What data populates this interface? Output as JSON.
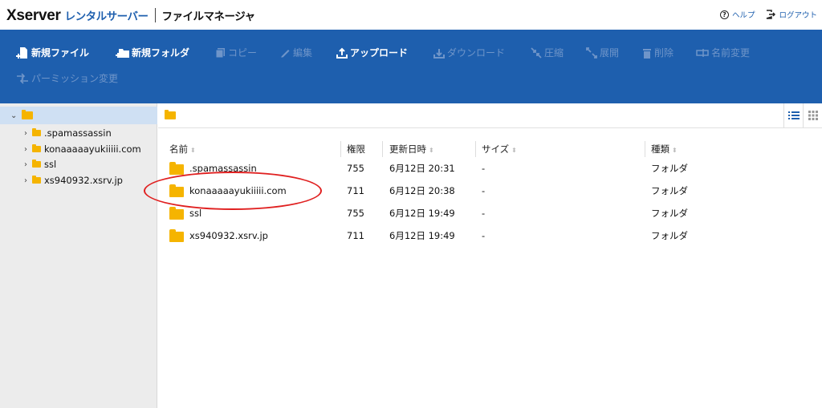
{
  "header": {
    "logo_main": "Xserver",
    "logo_sub": "レンタルサーバー",
    "app_title": "ファイルマネージャ",
    "help_label": "ヘルプ",
    "logout_label": "ログアウト"
  },
  "toolbar": {
    "new_file": "新規ファイル",
    "new_folder": "新規フォルダ",
    "copy": "コピー",
    "edit": "編集",
    "upload": "アップロード",
    "download": "ダウンロード",
    "compress": "圧縮",
    "extract": "展開",
    "delete": "削除",
    "rename": "名前変更",
    "permission": "パーミッション変更"
  },
  "tree": {
    "items": [
      {
        "label": ".spamassassin"
      },
      {
        "label": "konaaaaayukiiiii.com"
      },
      {
        "label": "ssl"
      },
      {
        "label": "xs940932.xsrv.jp"
      }
    ]
  },
  "table": {
    "headers": {
      "name": "名前",
      "perm": "権限",
      "date": "更新日時",
      "size": "サイズ",
      "type": "種類"
    },
    "rows": [
      {
        "name": ".spamassassin",
        "perm": "755",
        "date": "6月12日 20:31",
        "size": "-",
        "type": "フォルダ"
      },
      {
        "name": "konaaaaayukiiiii.com",
        "perm": "711",
        "date": "6月12日 20:38",
        "size": "-",
        "type": "フォルダ"
      },
      {
        "name": "ssl",
        "perm": "755",
        "date": "6月12日 19:49",
        "size": "-",
        "type": "フォルダ"
      },
      {
        "name": "xs940932.xsrv.jp",
        "perm": "711",
        "date": "6月12日 19:49",
        "size": "-",
        "type": "フォルダ"
      }
    ]
  },
  "colors": {
    "toolbar_bg": "#1e5fae",
    "folder": "#f5b400",
    "annotation": "#e02020"
  }
}
